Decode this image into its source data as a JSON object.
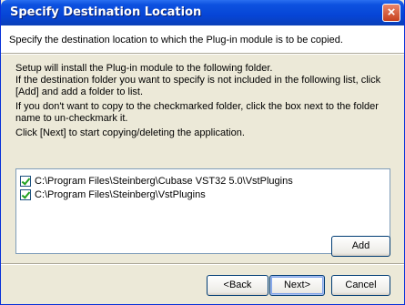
{
  "window": {
    "title": "Specify Destination Location",
    "close_label": "×"
  },
  "header": {
    "text": "Specify the destination location to which the Plug-in module is to be copied."
  },
  "body": {
    "setup_line": "Setup will install the Plug-in module to the following folder.",
    "add_info": "If the destination folder you want to specify is not included in the following list, click [Add] and add a folder to list.",
    "uncheck_info": "If you don't want to copy to the checkmarked folder, click the box next to the folder name to un-checkmark it.",
    "next_info": "Click [Next] to start copying/deleting the application."
  },
  "folders": [
    {
      "path": "C:\\Program Files\\Steinberg\\Cubase VST32 5.0\\VstPlugins",
      "checked": true
    },
    {
      "path": "C:\\Program Files\\Steinberg\\VstPlugins",
      "checked": true
    }
  ],
  "buttons": {
    "add": "Add",
    "back": "<Back",
    "next": "Next>",
    "cancel": "Cancel"
  }
}
